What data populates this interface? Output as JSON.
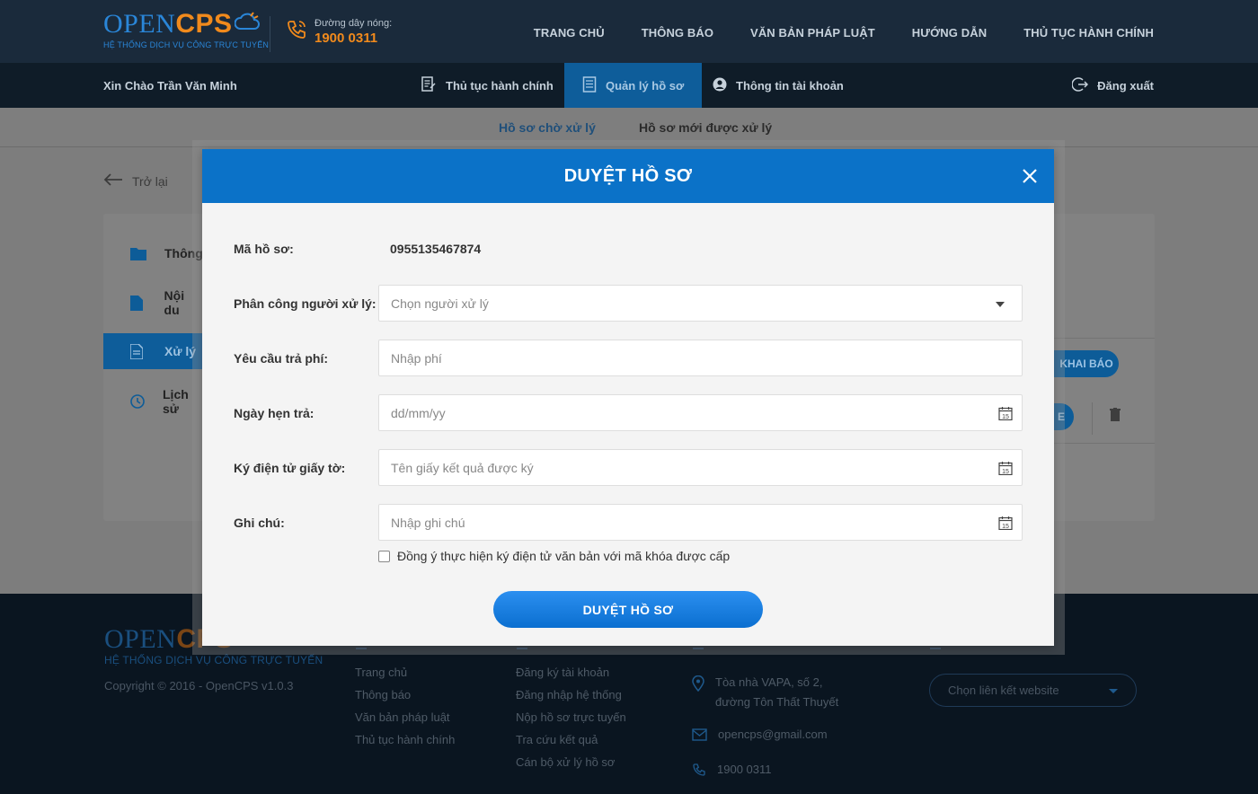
{
  "header": {
    "logo_open": "OPEN",
    "logo_cps": "CPS",
    "logo_subtitle": "HỆ THỐNG DỊCH VỤ CÔNG TRỰC TUYẾN",
    "hotline_label": "Đường dây nóng:",
    "hotline_number": "1900 0311",
    "nav": [
      "TRANG CHỦ",
      "THÔNG BÁO",
      "VĂN BẢN PHÁP LUẬT",
      "HƯỚNG DẪN",
      "THỦ TỤC HÀNH CHÍNH"
    ]
  },
  "userbar": {
    "greeting": "Xin Chào Trần Văn Minh",
    "tabs": [
      "Thủ tục hành chính",
      "Quản lý hồ sơ",
      "Thông tin tài khoản"
    ],
    "logout": "Đăng xuất"
  },
  "subtabs": [
    "Hồ sơ chờ xử lý",
    "Hồ sơ mới được xử lý"
  ],
  "page": {
    "back": "Trở lại",
    "sidebar": [
      "Thông",
      "Nội du",
      "Xử lý",
      "Lịch sử"
    ],
    "pill_khai_bao": "KHAI BÁO",
    "pill_e": "E"
  },
  "modal": {
    "title": "DUYỆT HỒ SƠ",
    "ma_ho_so_label": "Mã hồ sơ:",
    "ma_ho_so_value": "0955135467874",
    "assign_label": "Phân công người xử lý:",
    "assign_placeholder": "Chọn người xử lý",
    "fee_label": "Yêu cầu trả phí:",
    "fee_placeholder": "Nhập phí",
    "date_label": "Ngày hẹn trả:",
    "date_placeholder": "dd/mm/yy",
    "sign_label": "Ký điện tử giấy tờ:",
    "sign_placeholder": "Tên giấy kết quả được ký",
    "note_label": "Ghi chú:",
    "note_placeholder": "Nhập ghi chú",
    "agree_text": "Đồng ý thực hiện ký điện tử văn bản với mã khóa được cấp",
    "submit_label": "DUYỆT HỒ SƠ",
    "calendar_day": "15"
  },
  "footer": {
    "logo_open": "OPEN",
    "logo_cps": "CPS",
    "logo_subtitle": "HỆ THỐNG DỊCH VỤ CÔNG TRỰC TUYẾN",
    "copyright": "Copyright © 2016 - OpenCPS v1.0.3",
    "col1": [
      "Trang chủ",
      "Thông báo",
      "Văn bản pháp luật",
      "Thủ tục hành chính"
    ],
    "col2": [
      "Đăng ký tài khoản",
      "Đăng nhập hệ thống",
      "Nộp hồ sơ trực tuyến",
      "Tra cứu kết quả",
      "Cán bộ xử lý hồ sơ"
    ],
    "address_line1": "Tòa nhà VAPA, số 2,",
    "address_line2": "đường Tôn Thất Thuyết",
    "email": "opencps@gmail.com",
    "phone": "1900 0311",
    "link_select": "Chọn liên kết website"
  }
}
